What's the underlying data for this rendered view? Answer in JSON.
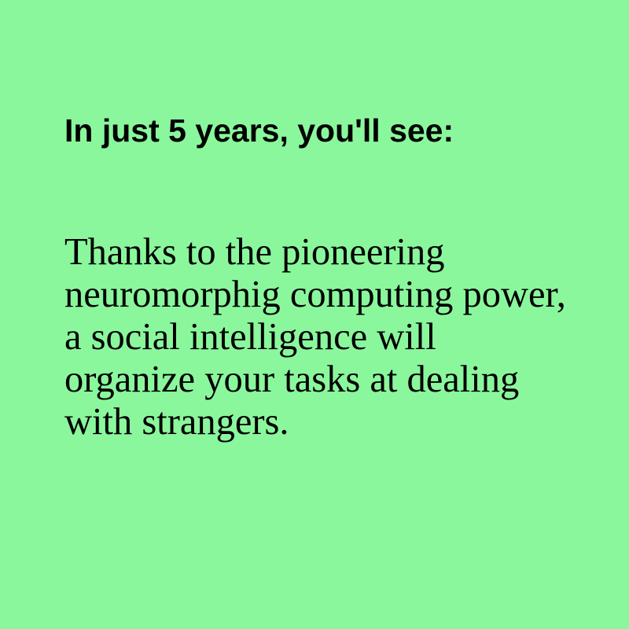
{
  "card": {
    "background_color": "#8af79c",
    "text_color": "#000000",
    "heading": "In just 5 years, you'll see:",
    "body": "Thanks to the pioneering neuromorphig computing power, a social intelligence will organize your tasks at dealing with strangers."
  }
}
